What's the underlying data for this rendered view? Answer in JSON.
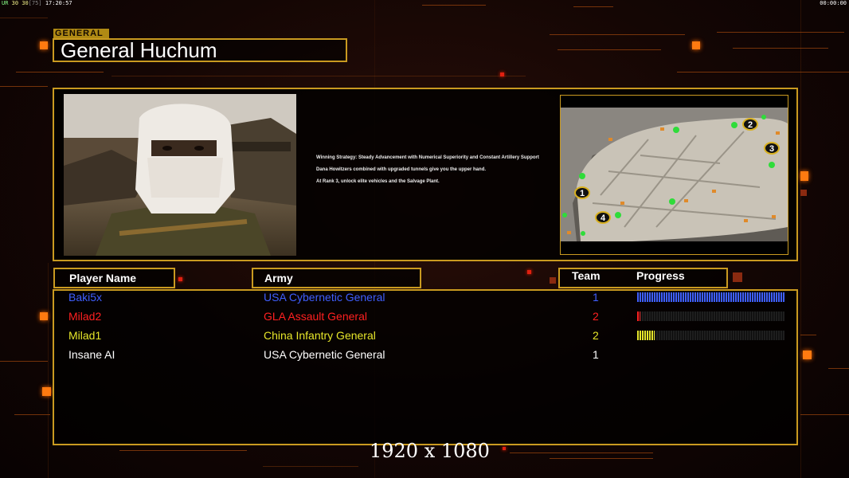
{
  "hud": {
    "left_a": "UR",
    "left_b": "30",
    "left_c": "30",
    "left_d": "[75]",
    "time": "17:20:57",
    "timer": "00:00:00"
  },
  "general": {
    "tag": "GENERAL",
    "name": "General Huchum"
  },
  "strategy": {
    "line1": "Winning Strategy: Steady Advancement with Numerical Superiority and Constant Artillery Support",
    "line2": "Dana Howitzers combined with upgraded tunnels give you the upper hand.",
    "line3": "At Rank 3, unlock elite vehicles and the Salvage Plant."
  },
  "map": {
    "start_positions": [
      "1",
      "2",
      "3",
      "4"
    ]
  },
  "headers": {
    "player_name": "Player Name",
    "army": "Army",
    "team": "Team",
    "progress": "Progress"
  },
  "players": [
    {
      "name": "Baki5x",
      "army": "USA Cybernetic General",
      "team": "1",
      "color": "#3f5fff",
      "progress": 1.0
    },
    {
      "name": "Milad2",
      "army": "GLA Assault General",
      "team": "2",
      "color": "#ff2020",
      "progress": 0.02
    },
    {
      "name": "Milad1",
      "army": "China Infantry General",
      "team": "2",
      "color": "#e6e62a",
      "progress": 0.12
    },
    {
      "name": "Insane AI",
      "army": "USA Cybernetic General",
      "team": "1",
      "color": "#ffffff",
      "progress": null
    }
  ],
  "resolution_label": "1920 x 1080",
  "colors": {
    "frame": "#c99a20",
    "accent_orange": "#ff7a10"
  }
}
